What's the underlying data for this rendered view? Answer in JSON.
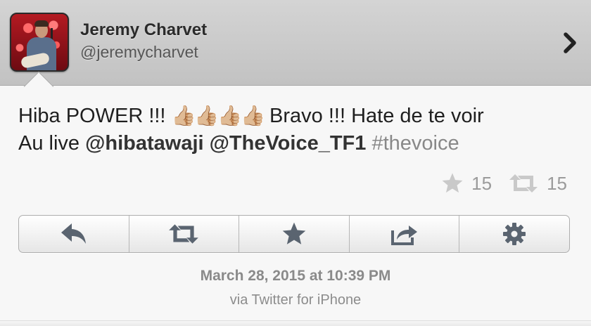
{
  "profile": {
    "name": "Jeremy Charvet",
    "handle": "@jeremycharvet",
    "avatar_icon": "profile-photo"
  },
  "tweet": {
    "text_part1": "Hiba POWER !!! ",
    "emoji": "👍🏼👍🏼👍🏼👍🏼",
    "text_part2": " Bravo !!! Hate de te voir",
    "text_part3": "Au live ",
    "mention1": "@hibatawaji",
    "mention2": "@TheVoice_TF1",
    "hashtag": "#thevoice"
  },
  "counts": {
    "favorites": "15",
    "retweets": "15"
  },
  "actions": [
    {
      "icon": "reply-icon"
    },
    {
      "icon": "retweet-icon"
    },
    {
      "icon": "star-icon"
    },
    {
      "icon": "share-icon"
    },
    {
      "icon": "gear-icon"
    }
  ],
  "footer": {
    "date": "March 28, 2015 at 10:39 PM",
    "via": "via Twitter for iPhone"
  },
  "colors": {
    "header_bg": "#c8c8c8",
    "body_bg": "#f7f7f7",
    "muted_text": "#8a8a8a",
    "icon_color": "#5a6470"
  }
}
